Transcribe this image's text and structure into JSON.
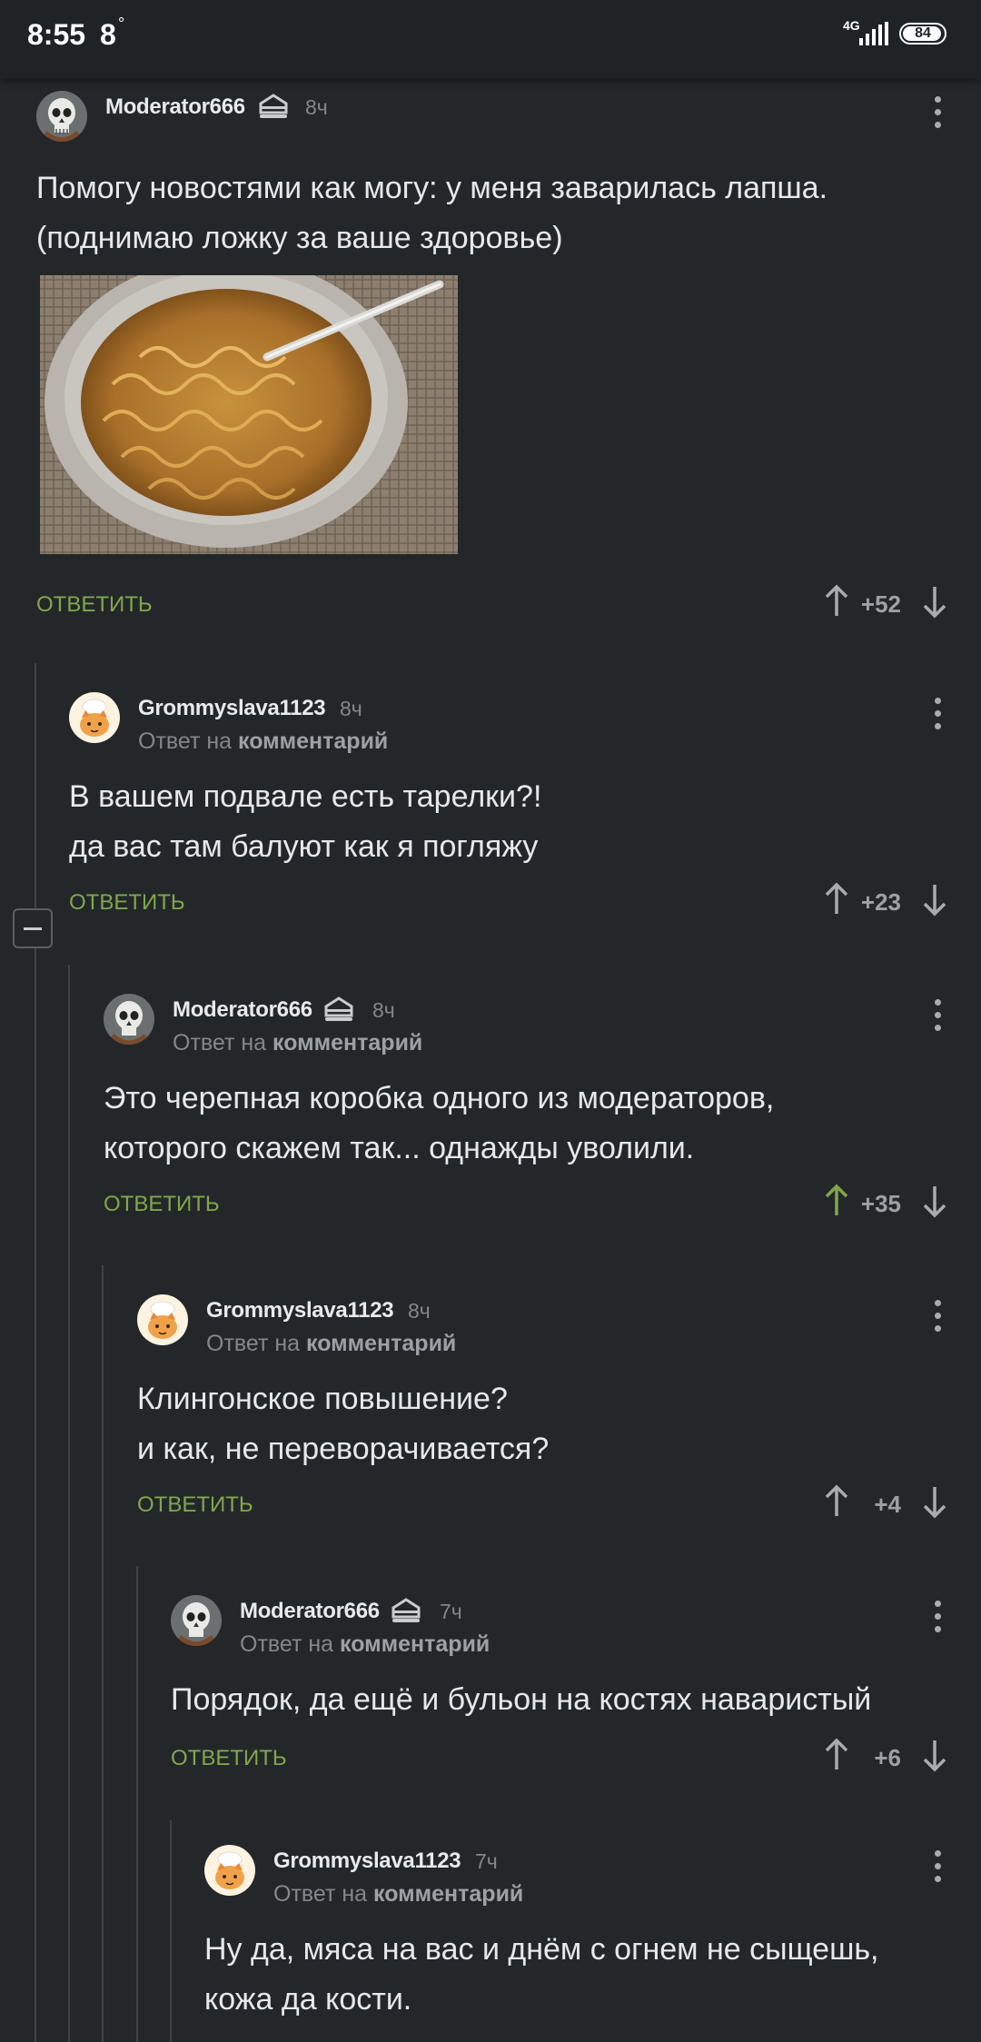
{
  "status_bar": {
    "time": "8:55",
    "temperature": "8",
    "network": "4G",
    "battery": "84"
  },
  "comments": [
    {
      "author": "Moderator666",
      "time": "8ч",
      "text": "Помогу новостями как могу: у меня заварилась лапша.\n(поднимаю ложку за ваше здоровье)",
      "reply_label": "ОТВЕТИТЬ",
      "score": "+52",
      "upvoted": false,
      "has_image": true,
      "image_icon": "noodle-bowl-photo"
    },
    {
      "author": "Grommyslava1123",
      "time": "8ч",
      "reply_prefix": "Ответ на",
      "reply_target": "комментарий",
      "text": "В вашем подвале есть тарелки?!\nда вас там балуют как я погляжу",
      "reply_label": "ОТВЕТИТЬ",
      "score": "+23",
      "upvoted": false
    },
    {
      "author": "Moderator666",
      "time": "8ч",
      "reply_prefix": "Ответ на",
      "reply_target": "комментарий",
      "text": "Это черепная коробка одного из модераторов,\nкоторого скажем так... однажды уволили.",
      "reply_label": "ОТВЕТИТЬ",
      "score": "+35",
      "upvoted": true
    },
    {
      "author": "Grommyslava1123",
      "time": "8ч",
      "reply_prefix": "Ответ на",
      "reply_target": "комментарий",
      "text": "Клингонское повышение?\nи как, не переворачивается?",
      "reply_label": "ОТВЕТИТЬ",
      "score": "+4",
      "upvoted": false
    },
    {
      "author": "Moderator666",
      "time": "7ч",
      "reply_prefix": "Ответ на",
      "reply_target": "комментарий",
      "text": "Порядок, да ещё и бульон на костях наваристый",
      "reply_label": "ОТВЕТИТЬ",
      "score": "+6",
      "upvoted": false
    },
    {
      "author": "Grommyslava1123",
      "time": "7ч",
      "reply_prefix": "Ответ на",
      "reply_target": "комментарий",
      "text": "Ну да, мяса на вас и днём с огнем не сыщешь,\nкожа да кости."
    }
  ],
  "colors": {
    "background": "#23272a",
    "accent_green": "#7fa84b",
    "muted_text": "#81878c"
  }
}
